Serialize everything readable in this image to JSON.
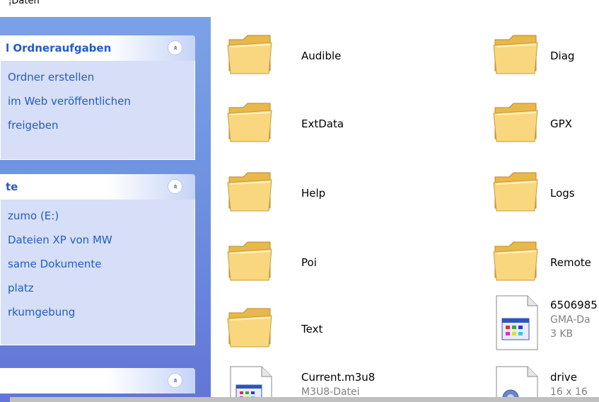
{
  "address": {
    "text": "¦Daten"
  },
  "taskpane": {
    "panels": [
      {
        "title": "l Ordneraufgaben",
        "items": [
          "Ordner erstellen",
          "im Web veröffentlichen",
          "freigeben"
        ]
      },
      {
        "title": "te",
        "items": [
          "zumo (E:)",
          "Dateien XP von MW",
          "same Dokumente",
          "platz",
          "rkumgebung"
        ]
      },
      {
        "title": "",
        "items": []
      }
    ],
    "collapse_glyph": "«"
  },
  "files": {
    "col1": [
      {
        "name": "Audible",
        "type": "folder"
      },
      {
        "name": "ExtData",
        "type": "folder"
      },
      {
        "name": "Help",
        "type": "folder"
      },
      {
        "name": "Poi",
        "type": "folder"
      },
      {
        "name": "Text",
        "type": "folder"
      },
      {
        "name": "Current.m3u8",
        "type": "file",
        "sub1": "M3U8-Datei"
      }
    ],
    "col2": [
      {
        "name": "Diag",
        "type": "folder"
      },
      {
        "name": "GPX",
        "type": "folder"
      },
      {
        "name": "Logs",
        "type": "folder"
      },
      {
        "name": "Remote",
        "type": "folder"
      },
      {
        "name": "6506985",
        "type": "file",
        "sub1": "GMA-Da",
        "sub2": "3 KB"
      },
      {
        "name": "drive",
        "type": "image",
        "sub1": "16 x 16"
      }
    ]
  },
  "colors": {
    "pane_blue": "#6d8fe0",
    "panel_body": "#d6dff7",
    "link_blue": "#215dc6",
    "folder_yellow": "#f9d77e"
  }
}
